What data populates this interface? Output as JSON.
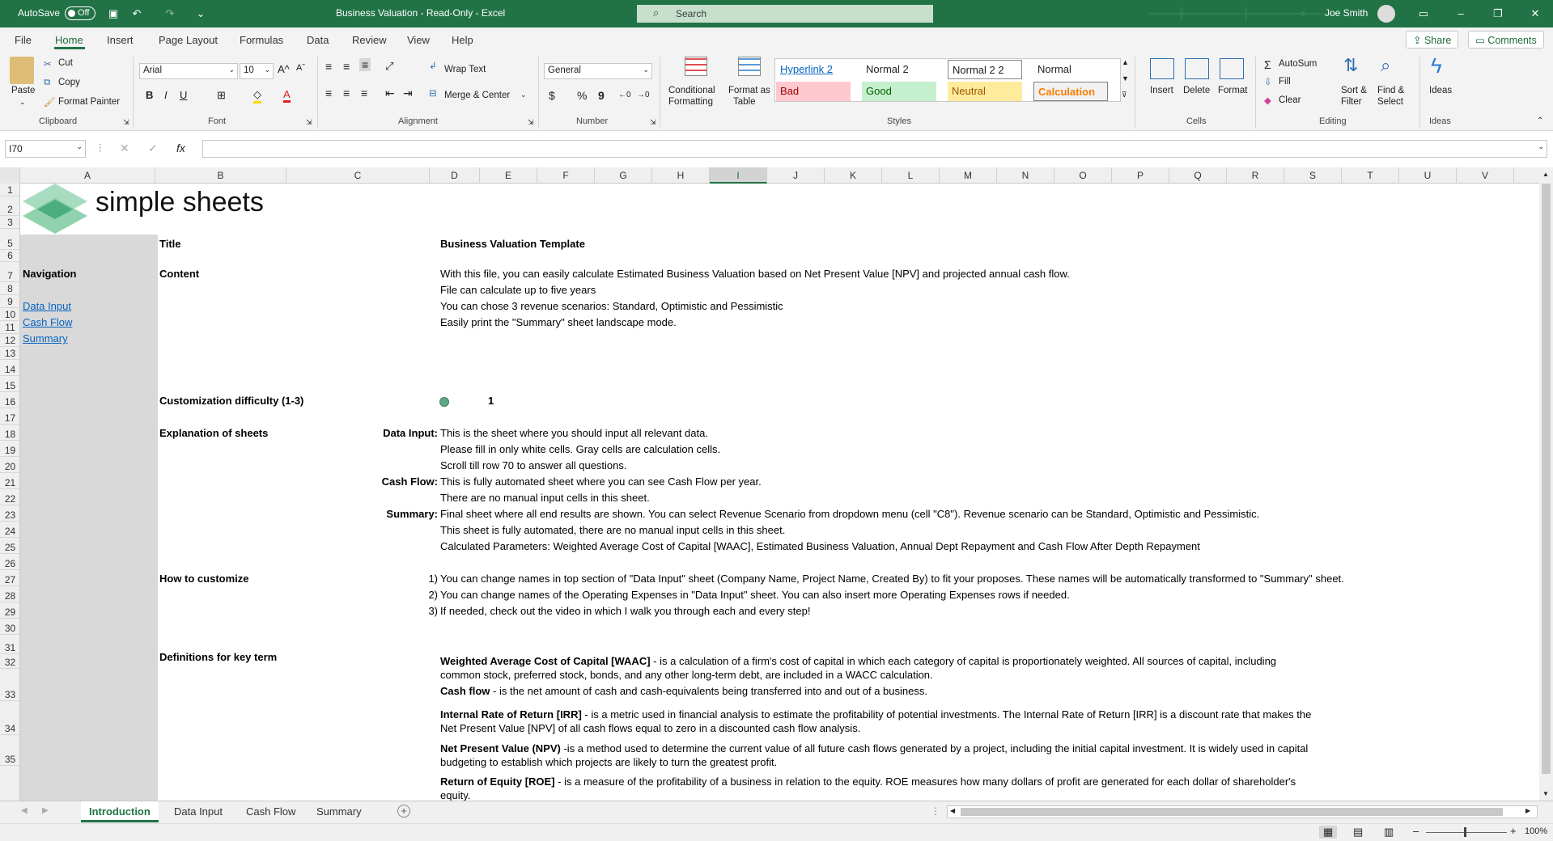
{
  "titlebar": {
    "autosave_label": "AutoSave",
    "autosave_state": "Off",
    "doc_title": "Business Valuation  -  Read-Only  -  Excel",
    "search_placeholder": "Search",
    "user_name": "Joe Smith",
    "colors": {
      "brand": "#217346"
    }
  },
  "ribbon_tabs": [
    "File",
    "Home",
    "Insert",
    "Page Layout",
    "Formulas",
    "Data",
    "Review",
    "View",
    "Help"
  ],
  "active_tab": "Home",
  "share_label": "Share",
  "comments_label": "Comments",
  "clipboard": {
    "paste": "Paste",
    "cut": "Cut",
    "copy": "Copy",
    "format_painter": "Format Painter",
    "group": "Clipboard"
  },
  "font": {
    "name": "Arial",
    "size": "10",
    "bold": "B",
    "italic": "I",
    "underline": "U",
    "group": "Font"
  },
  "alignment": {
    "wrap_text": "Wrap Text",
    "merge_center": "Merge & Center",
    "group": "Alignment"
  },
  "number": {
    "format": "General",
    "currency": "$",
    "percent": "%",
    "comma": "9",
    "group": "Number"
  },
  "styles": {
    "conditional": [
      "Conditional",
      "Formatting"
    ],
    "format_table": [
      "Format as",
      "Table"
    ],
    "cells": [
      {
        "label": "Hyperlink 2",
        "bg": "#ffffff",
        "color": "#0563c1"
      },
      {
        "label": "Normal 2",
        "bg": "#ffffff",
        "color": "#000000"
      },
      {
        "label": "Normal 2 2",
        "bg": "#ffffff",
        "color": "#000000"
      },
      {
        "label": "Normal",
        "bg": "#ffffff",
        "color": "#000000"
      },
      {
        "label": "Bad",
        "bg": "#ffc7ce",
        "color": "#9c0006"
      },
      {
        "label": "Good",
        "bg": "#c6efce",
        "color": "#006100"
      },
      {
        "label": "Neutral",
        "bg": "#ffeb9c",
        "color": "#9c5700"
      },
      {
        "label": "Calculation",
        "bg": "#f2f2f2",
        "color": "#fa7d00"
      }
    ],
    "group": "Styles"
  },
  "cells_group": {
    "insert": "Insert",
    "delete": "Delete",
    "format": "Format",
    "group": "Cells"
  },
  "editing": {
    "autosum": "AutoSum",
    "fill": "Fill",
    "clear": "Clear",
    "sort": [
      "Sort &",
      "Filter"
    ],
    "find": [
      "Find &",
      "Select"
    ],
    "group": "Editing"
  },
  "ideas": {
    "label": "Ideas",
    "group": "Ideas"
  },
  "formula_bar": {
    "name_box": "I70",
    "fx": "fx",
    "value": ""
  },
  "columns": [
    "A",
    "B",
    "C",
    "D",
    "E",
    "F",
    "G",
    "H",
    "I",
    "J",
    "K",
    "L",
    "M",
    "N",
    "O",
    "P",
    "Q",
    "R",
    "S",
    "T",
    "U",
    "V"
  ],
  "selected_column": "I",
  "rows": [
    "1",
    "2",
    "3",
    "5",
    "6",
    "7",
    "8",
    "9",
    "10",
    "11",
    "12",
    "13",
    "14",
    "15",
    "16",
    "17",
    "18",
    "19",
    "20",
    "21",
    "22",
    "23",
    "24",
    "25",
    "26",
    "27",
    "28",
    "29",
    "30",
    "31",
    "32",
    "33",
    "34",
    "35"
  ],
  "sheet": {
    "logo_text": "simple sheets",
    "nav_title": "Navigation",
    "nav_links": [
      "Data Input",
      "Cash Flow",
      "Summary"
    ],
    "title_label": "Title",
    "title_value": "Business Valuation Template",
    "content_label": "Content",
    "content_lines": [
      "With this file, you can easily calculate Estimated Business Valuation based on Net Present Value [NPV] and projected annual cash flow.",
      "File can calculate up to five years",
      "You can chose 3 revenue scenarios: Standard, Optimistic and Pessimistic",
      "Easily print the \"Summary\" sheet landscape mode."
    ],
    "difficulty_label": "Customization difficulty (1-3)",
    "difficulty_value": "1",
    "difficulty_color": "#5fa782",
    "explain_label": "Explanation of sheets",
    "explain": [
      {
        "key": "Data Input:",
        "lines": [
          "This is the sheet where you should input all relevant data.",
          "Please fill in only white cells. Gray cells are calculation cells.",
          "Scroll till row 70 to answer all questions."
        ]
      },
      {
        "key": "Cash Flow:",
        "lines": [
          "This is fully automated sheet where you can see Cash Flow per year.",
          "There are no manual input cells in this sheet."
        ]
      },
      {
        "key": "Summary:",
        "lines": [
          "Final sheet where all end results are shown. You can select Revenue Scenario from dropdown menu (cell \"C8\"). Revenue scenario can be Standard, Optimistic and Pessimistic.",
          "This sheet is fully automated, there are no manual input cells in this sheet.",
          "Calculated Parameters: Weighted Average Cost of Capital [WAAC], Estimated Business Valuation, Annual Dept Repayment and Cash Flow After Depth Repayment"
        ]
      }
    ],
    "customize_label": "How to customize",
    "customize": [
      {
        "num": "1)",
        "text": "You can change names in top section of \"Data Input\" sheet (Company Name, Project Name, Created By) to fit your proposes. These names will be automatically transformed to \"Summary\" sheet."
      },
      {
        "num": "2)",
        "text": "You can change names of the Operating Expenses in  \"Data Input\" sheet. You can also insert more Operating Expenses rows if needed."
      },
      {
        "num": "3)",
        "text": "If needed, check out the video in which I walk you through each and every step!"
      }
    ],
    "definitions_label": "Definitions for key term",
    "definitions": [
      {
        "term": "Weighted Average Cost of Capital [WAAC]",
        "text": " -  is a calculation of a firm's cost of capital in which each category of capital is proportionately weighted. All sources of capital, including common stock, preferred stock, bonds, and any other long-term debt, are included in a WACC calculation."
      },
      {
        "term": "Cash flow",
        "text": " -  is the net amount of cash and cash-equivalents being transferred into and out of a business."
      },
      {
        "term": "Internal Rate of Return [IRR]",
        "text": " - is a metric used in financial analysis to estimate the profitability of potential investments. The Internal Rate of Return [IRR] is a discount rate that makes the Net Present Value [NPV] of all cash flows equal to zero in a discounted cash flow analysis."
      },
      {
        "term": "Net Present Value (NPV)",
        "text": " -is a method used to determine the current value of all future cash flows generated by a project, including the initial capital investment. It is widely used in capital budgeting to establish which projects are likely to turn the greatest profit."
      },
      {
        "term": "Return of Equity [ROE]",
        "text": " - is a measure of the profitability of a business in relation to the equity. ROE measures how many dollars of profit are generated for each dollar of shareholder's equity."
      }
    ]
  },
  "sheet_tabs": [
    "Introduction",
    "Data Input",
    "Cash Flow",
    "Summary"
  ],
  "active_sheet": "Introduction",
  "status": {
    "zoom": "100%"
  }
}
